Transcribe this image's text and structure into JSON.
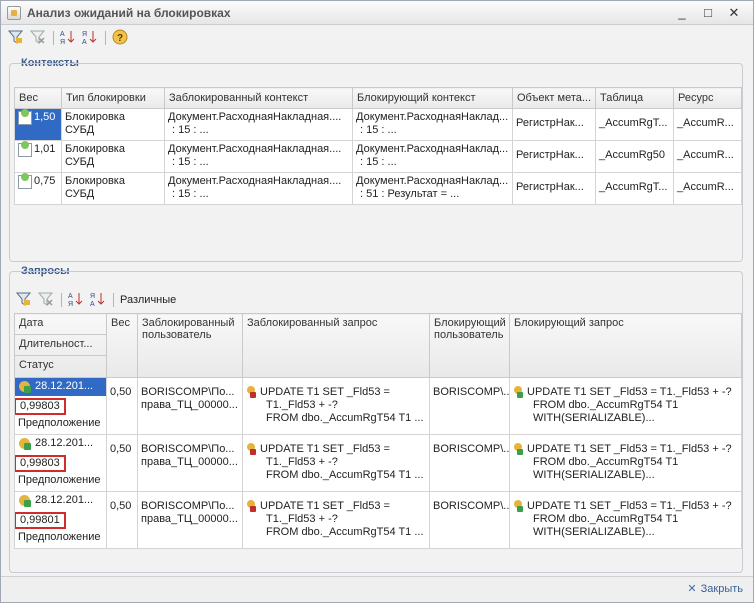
{
  "window": {
    "title": "Анализ ожиданий на блокировках",
    "controls": [
      "_",
      "□",
      "✕"
    ]
  },
  "contexts": {
    "group_title": "Контексты",
    "headers": [
      "Вес",
      "Тип блокировки",
      "Заблокированный контекст",
      "Блокирующий контекст",
      "Объект мета...",
      "Таблица",
      "Ресурс"
    ],
    "rows": [
      {
        "weight": "1,50",
        "type_1": "Блокировка",
        "type_2": "СУБД",
        "blocked_1": "Документ.РасходнаяНакладная....",
        "blocked_2": ": 15 : ...",
        "blocking_1": "Документ.РасходнаяНаклад...",
        "blocking_2": ": 15 : ...",
        "object": "РегистрНак...",
        "table": "_AccumRgT...",
        "resource": "_AccumR..."
      },
      {
        "weight": "1,01",
        "type_1": "Блокировка",
        "type_2": "СУБД",
        "blocked_1": "Документ.РасходнаяНакладная....",
        "blocked_2": ": 15 : ...",
        "blocking_1": "Документ.РасходнаяНаклад...",
        "blocking_2": ": 15 : ...",
        "object": "РегистрНак...",
        "table": "_AccumRg50",
        "resource": "_AccumR..."
      },
      {
        "weight": "0,75",
        "type_1": "Блокировка",
        "type_2": "СУБД",
        "blocked_1": "Документ.РасходнаяНакладная....",
        "blocked_2": ": 15 : ...",
        "blocking_1": "Документ.РасходнаяНаклад...",
        "blocking_2": ": 51 : Результат = ...",
        "object": "РегистрНак...",
        "table": "_AccumRgT...",
        "resource": "_AccumR..."
      }
    ]
  },
  "queries": {
    "group_title": "Запросы",
    "toolbar_label": "Различные",
    "headers": {
      "date": "Дата",
      "duration": "Длительност...",
      "status": "Статус",
      "weight": "Вес",
      "blocked_user": "Заблокированный пользователь",
      "blocked_query": "Заблокированный запрос",
      "blocking_user": "Блокирующий пользователь",
      "blocking_query": "Блокирующий запрос"
    },
    "rows": [
      {
        "date": "28.12.201...",
        "duration": "0,99803",
        "status": "Предположение",
        "weight": "0,50",
        "blocked_user_1": "BORISCOMP\\По...",
        "blocked_user_2": "права_ТЦ_00000...",
        "bq_1": "UPDATE T1 SET _Fld53 =",
        "bq_2": "T1._Fld53 + -?",
        "bq_3": "FROM dbo._AccumRgT54 T1 ...",
        "blocking_user": "BORISCOMP\\...",
        "gq_1": "UPDATE T1 SET _Fld53 = T1._Fld53 + -?",
        "gq_2": "FROM dbo._AccumRgT54 T1",
        "gq_3": "WITH(SERIALIZABLE)..."
      },
      {
        "date": "28.12.201...",
        "duration": "0,99803",
        "status": "Предположение",
        "weight": "0,50",
        "blocked_user_1": "BORISCOMP\\По...",
        "blocked_user_2": "права_ТЦ_00000...",
        "bq_1": "UPDATE T1 SET _Fld53 =",
        "bq_2": "T1._Fld53 + -?",
        "bq_3": "FROM dbo._AccumRgT54 T1 ...",
        "blocking_user": "BORISCOMP\\...",
        "gq_1": "UPDATE T1 SET _Fld53 = T1._Fld53 + -?",
        "gq_2": "FROM dbo._AccumRgT54 T1",
        "gq_3": "WITH(SERIALIZABLE)..."
      },
      {
        "date": "28.12.201...",
        "duration": "0,99801",
        "status": "Предположение",
        "weight": "0,50",
        "blocked_user_1": "BORISCOMP\\По...",
        "blocked_user_2": "права_ТЦ_00000...",
        "bq_1": "UPDATE T1 SET _Fld53 =",
        "bq_2": "T1._Fld53 + -?",
        "bq_3": "FROM dbo._AccumRgT54 T1 ...",
        "blocking_user": "BORISCOMP\\...",
        "gq_1": "UPDATE T1 SET _Fld53 = T1._Fld53 + -?",
        "gq_2": "FROM dbo._AccumRgT54 T1",
        "gq_3": "WITH(SERIALIZABLE)..."
      }
    ]
  },
  "footer": {
    "close_label": "Закрыть"
  },
  "colors": {
    "accent": "#316ac5",
    "highlight_border": "#d12b2b",
    "group_title": "#3b5b8a"
  },
  "icons": [
    "filter-icon",
    "filter-clear-icon",
    "sort-asc-icon",
    "sort-desc-icon",
    "help-icon",
    "lock-icon",
    "close-icon"
  ]
}
